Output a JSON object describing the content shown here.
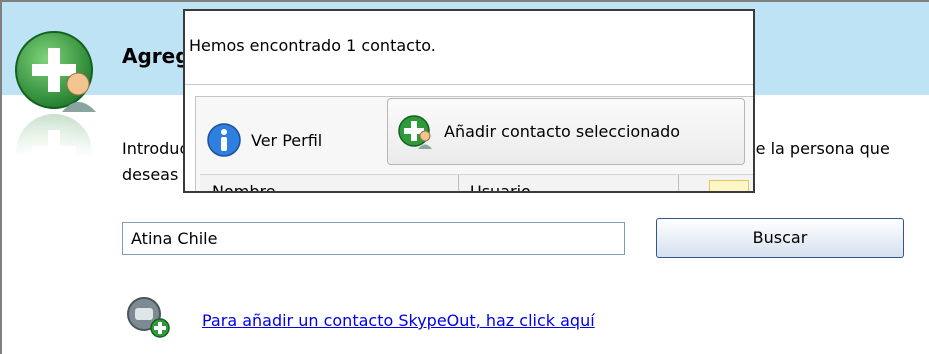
{
  "header": {
    "title": "Agregar contacto"
  },
  "intro": {
    "text": "Introduce el nombre, el nombre de Skype o la dirección de correo electrónico de la persona que deseas agregar como contacto."
  },
  "search": {
    "value": "Atina Chile",
    "button_label": "Buscar"
  },
  "skypeout": {
    "link_label": "Para añadir un contacto SkypeOut, haz click aquí"
  },
  "popup": {
    "message": "Hemos encontrado 1 contacto.",
    "toolbar": {
      "view_profile_label": "Ver Perfil",
      "add_selected_label": "Añadir contacto seleccionado"
    },
    "columns": [
      "Nombre",
      "Usuario"
    ]
  },
  "colors": {
    "header_band": "#bde3f5",
    "link": "#0000ee",
    "icon_green": "#2e9a3a"
  },
  "icons": [
    "add-contact-icon",
    "info-icon",
    "skypeout-phone-icon"
  ]
}
